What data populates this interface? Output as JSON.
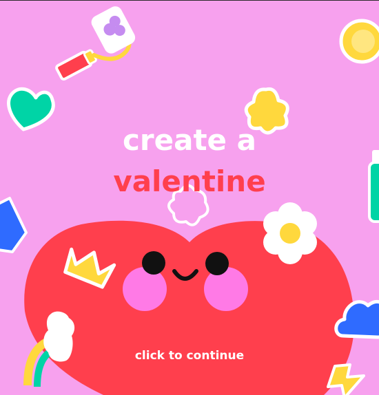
{
  "screen": {
    "title_line1": "create a",
    "title_line2": "valentine",
    "continue_label": "click to continue"
  },
  "colors": {
    "background": "#f7a1ee",
    "title_line1": "#ffffff",
    "title_line2": "#ff3f4d",
    "heart": "#ff3f4d",
    "cheeks": "#ff7ae6",
    "face": "#111111",
    "stickers_yellow": "#ffd83d",
    "stickers_teal": "#00d4a6",
    "stickers_blue": "#2f6bff"
  },
  "icons": [
    "paint-roller-icon",
    "teal-heart-icon",
    "star-flower-icon",
    "sun-flower-icon",
    "blue-gem-icon",
    "teal-bottle-icon",
    "outline-star-icon",
    "crown-icon",
    "daisy-icon",
    "cloud-icon",
    "rainbow-icon",
    "lightning-icon"
  ]
}
